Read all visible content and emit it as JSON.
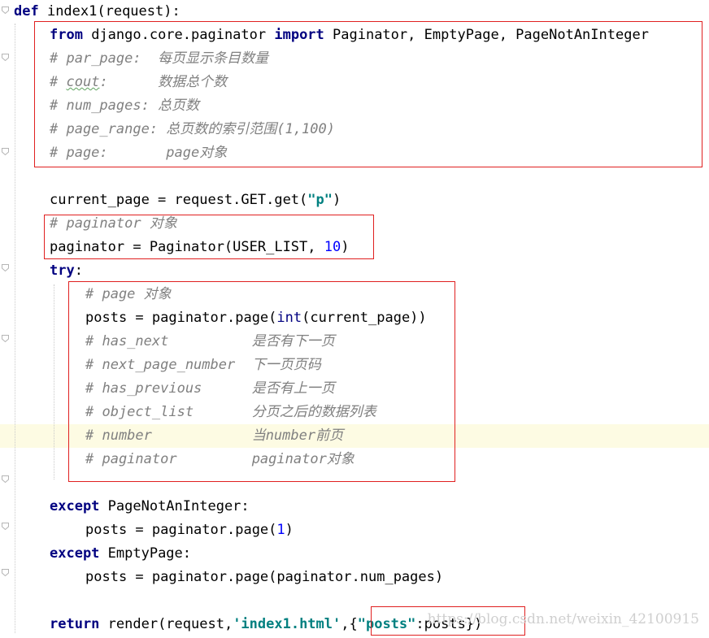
{
  "editor": {
    "lines": [
      {
        "indent": 0,
        "tokens": [
          {
            "t": "def",
            "c": "kw"
          },
          {
            "t": " index1(request):"
          }
        ]
      },
      {
        "indent": 1,
        "tokens": [
          {
            "t": "from",
            "c": "kw"
          },
          {
            "t": " django.core.paginator "
          },
          {
            "t": "import",
            "c": "kw"
          },
          {
            "t": " Paginator, EmptyPage, PageNotAnInteger"
          }
        ]
      },
      {
        "indent": 1,
        "tokens": [
          {
            "t": "# par_page:  每页显示条目数量",
            "c": "cm"
          }
        ]
      },
      {
        "indent": 1,
        "tokens": [
          {
            "t": "# ",
            "c": "cm"
          },
          {
            "t": "cout",
            "c": "cm sq"
          },
          {
            "t": ":      数据总个数",
            "c": "cm"
          }
        ]
      },
      {
        "indent": 1,
        "tokens": [
          {
            "t": "# num_pages: 总页数",
            "c": "cm"
          }
        ]
      },
      {
        "indent": 1,
        "tokens": [
          {
            "t": "# page_range: 总页数的索引范围(1,100)",
            "c": "cm"
          }
        ]
      },
      {
        "indent": 1,
        "tokens": [
          {
            "t": "# page:       page对象",
            "c": "cm"
          }
        ]
      },
      {
        "indent": 1,
        "tokens": []
      },
      {
        "indent": 1,
        "tokens": [
          {
            "t": "current_page = request.GET.get("
          },
          {
            "t": "\"p\"",
            "c": "str"
          },
          {
            "t": ")"
          }
        ]
      },
      {
        "indent": 1,
        "tokens": [
          {
            "t": "# paginator 对象",
            "c": "cm"
          }
        ]
      },
      {
        "indent": 1,
        "tokens": [
          {
            "t": "paginator = Paginator(USER_LIST, "
          },
          {
            "t": "10",
            "c": "num"
          },
          {
            "t": ")"
          }
        ]
      },
      {
        "indent": 1,
        "tokens": [
          {
            "t": "try",
            "c": "kw"
          },
          {
            "t": ":"
          }
        ]
      },
      {
        "indent": 2,
        "tokens": [
          {
            "t": "# page 对象",
            "c": "cm"
          }
        ]
      },
      {
        "indent": 2,
        "tokens": [
          {
            "t": "posts = paginator.page("
          },
          {
            "t": "int",
            "c": "kw-lite"
          },
          {
            "t": "(current_page))"
          }
        ]
      },
      {
        "indent": 2,
        "tokens": [
          {
            "t": "# has_next          是否有下一页",
            "c": "cm"
          }
        ]
      },
      {
        "indent": 2,
        "tokens": [
          {
            "t": "# next_page_number  下一页页码",
            "c": "cm"
          }
        ]
      },
      {
        "indent": 2,
        "tokens": [
          {
            "t": "# has_previous      是否有上一页",
            "c": "cm"
          }
        ]
      },
      {
        "indent": 2,
        "tokens": [
          {
            "t": "# object_list       分页之后的数据列表",
            "c": "cm"
          }
        ]
      },
      {
        "indent": 2,
        "tokens": [
          {
            "t": "# number            当number前页",
            "c": "cm"
          }
        ]
      },
      {
        "indent": 2,
        "tokens": [
          {
            "t": "# paginator         paginator对象",
            "c": "cm"
          }
        ]
      },
      {
        "indent": 1,
        "tokens": []
      },
      {
        "indent": 1,
        "tokens": [
          {
            "t": "except",
            "c": "kw"
          },
          {
            "t": " PageNotAnInteger:"
          }
        ]
      },
      {
        "indent": 2,
        "tokens": [
          {
            "t": "posts = paginator.page("
          },
          {
            "t": "1",
            "c": "num"
          },
          {
            "t": ")"
          }
        ]
      },
      {
        "indent": 1,
        "tokens": [
          {
            "t": "except",
            "c": "kw"
          },
          {
            "t": " EmptyPage:"
          }
        ]
      },
      {
        "indent": 2,
        "tokens": [
          {
            "t": "posts = paginator.page(paginator.num_pages)"
          }
        ]
      },
      {
        "indent": 1,
        "tokens": []
      },
      {
        "indent": 1,
        "tokens": [
          {
            "t": "return",
            "c": "kw"
          },
          {
            "t": " render(request,"
          },
          {
            "t": "'index1.html'",
            "c": "str"
          },
          {
            "t": ",{"
          },
          {
            "t": "\"posts\"",
            "c": "str"
          },
          {
            "t": ":posts})"
          }
        ]
      }
    ],
    "highlighted_line": 18
  },
  "watermark": "https://blog.csdn.net/weixin_42100915",
  "colors": {
    "keyword": "#000080",
    "comment": "#808080",
    "string": "#008080",
    "number": "#0000ff",
    "annotation_box": "#e02020",
    "current_line": "#fdfbe3"
  }
}
